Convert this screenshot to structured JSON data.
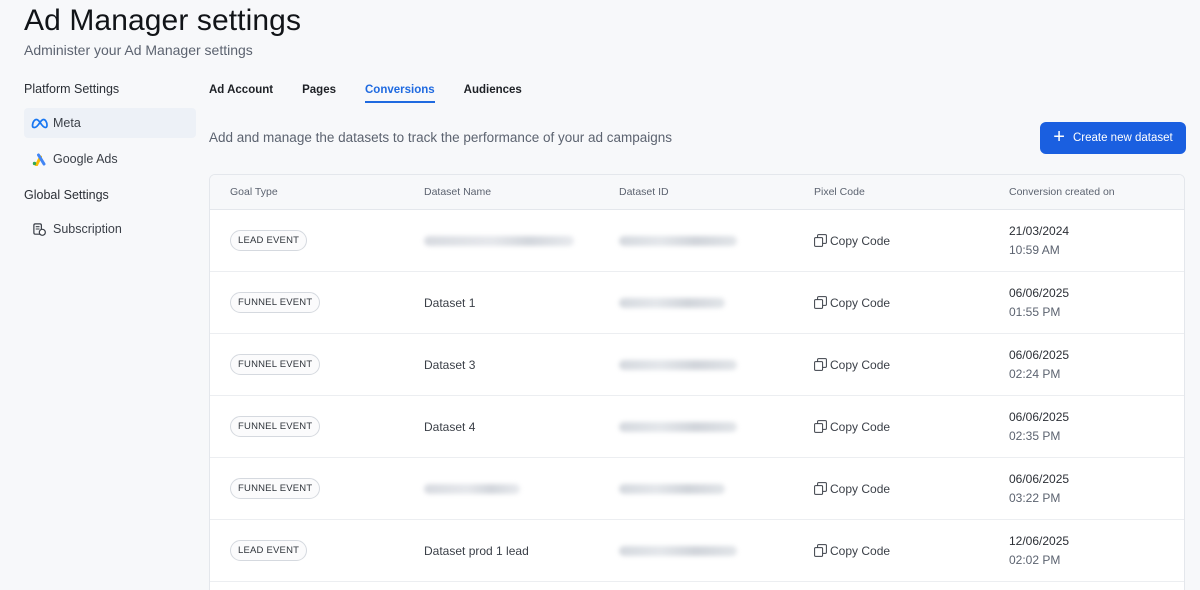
{
  "header": {
    "title": "Ad Manager settings",
    "subtitle": "Administer your Ad Manager settings"
  },
  "sidebar": {
    "platform_label": "Platform Settings",
    "global_label": "Global Settings",
    "items": [
      {
        "label": "Meta",
        "icon": "meta-icon",
        "active": true
      },
      {
        "label": "Google Ads",
        "icon": "google-ads-icon",
        "active": false
      },
      {
        "label": "Subscription",
        "icon": "subscription-icon",
        "active": false
      }
    ]
  },
  "tabs": [
    {
      "label": "Ad Account",
      "active": false
    },
    {
      "label": "Pages",
      "active": false
    },
    {
      "label": "Conversions",
      "active": true
    },
    {
      "label": "Audiences",
      "active": false
    }
  ],
  "main": {
    "description": "Add and manage the datasets to track the performance of your ad campaigns",
    "create_button": "Create new dataset"
  },
  "table": {
    "headers": [
      "Goal Type",
      "Dataset Name",
      "Dataset ID",
      "Pixel Code",
      "Conversion created on"
    ],
    "copy_label": "Copy Code",
    "rows": [
      {
        "goal": "LEAD EVENT",
        "name": "",
        "date": "21/03/2024",
        "time": "10:59 AM"
      },
      {
        "goal": "FUNNEL EVENT",
        "name": "Dataset 1",
        "date": "06/06/2025",
        "time": "01:55 PM"
      },
      {
        "goal": "FUNNEL EVENT",
        "name": "Dataset 3",
        "date": "06/06/2025",
        "time": "02:24 PM"
      },
      {
        "goal": "FUNNEL EVENT",
        "name": "Dataset 4",
        "date": "06/06/2025",
        "time": "02:35 PM"
      },
      {
        "goal": "FUNNEL EVENT",
        "name": "",
        "date": "06/06/2025",
        "time": "03:22 PM"
      },
      {
        "goal": "LEAD EVENT",
        "name": "Dataset prod 1 lead",
        "date": "12/06/2025",
        "time": "02:02 PM"
      }
    ]
  },
  "colors": {
    "accent": "#1a5fe0",
    "active_tab": "#1f6ae0",
    "background": "#f7f8fa"
  }
}
